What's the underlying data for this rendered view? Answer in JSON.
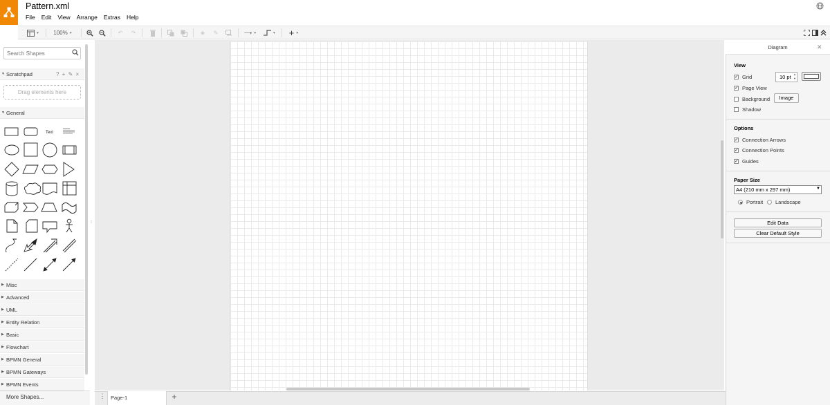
{
  "app": {
    "title": "Pattern.xml",
    "brand_color": "#f08705"
  },
  "menu": [
    "File",
    "Edit",
    "View",
    "Arrange",
    "Extras",
    "Help"
  ],
  "toolbar": {
    "zoom": "100%"
  },
  "sidebar": {
    "search_placeholder": "Search Shapes",
    "scratchpad": {
      "label": "Scratchpad",
      "icons": "? + ✎ ×",
      "drop_hint": "Drag elements here"
    },
    "general_label": "General",
    "text_shape_label": "Text",
    "categories": [
      "Misc",
      "Advanced",
      "UML",
      "Entity Relation",
      "Basic",
      "Flowchart",
      "BPMN General",
      "BPMN Gateways",
      "BPMN Events"
    ],
    "more_shapes": "More Shapes..."
  },
  "pages": {
    "tabs": [
      "Page-1"
    ]
  },
  "format_panel": {
    "title": "Diagram",
    "view": {
      "heading": "View",
      "grid": {
        "label": "Grid",
        "checked": true,
        "size": "10 pt"
      },
      "page_view": {
        "label": "Page View",
        "checked": true
      },
      "background": {
        "label": "Background",
        "checked": false,
        "button": "Image"
      },
      "shadow": {
        "label": "Shadow",
        "checked": false
      }
    },
    "options": {
      "heading": "Options",
      "items": [
        {
          "label": "Connection Arrows",
          "checked": true
        },
        {
          "label": "Connection Points",
          "checked": true
        },
        {
          "label": "Guides",
          "checked": true
        }
      ]
    },
    "paper_size": {
      "heading": "Paper Size",
      "selected": "A4 (210 mm x 297 mm)",
      "orientation": {
        "portrait": "Portrait",
        "landscape": "Landscape",
        "selected": "Portrait"
      }
    },
    "buttons": {
      "edit_data": "Edit Data",
      "clear_style": "Clear Default Style"
    }
  }
}
